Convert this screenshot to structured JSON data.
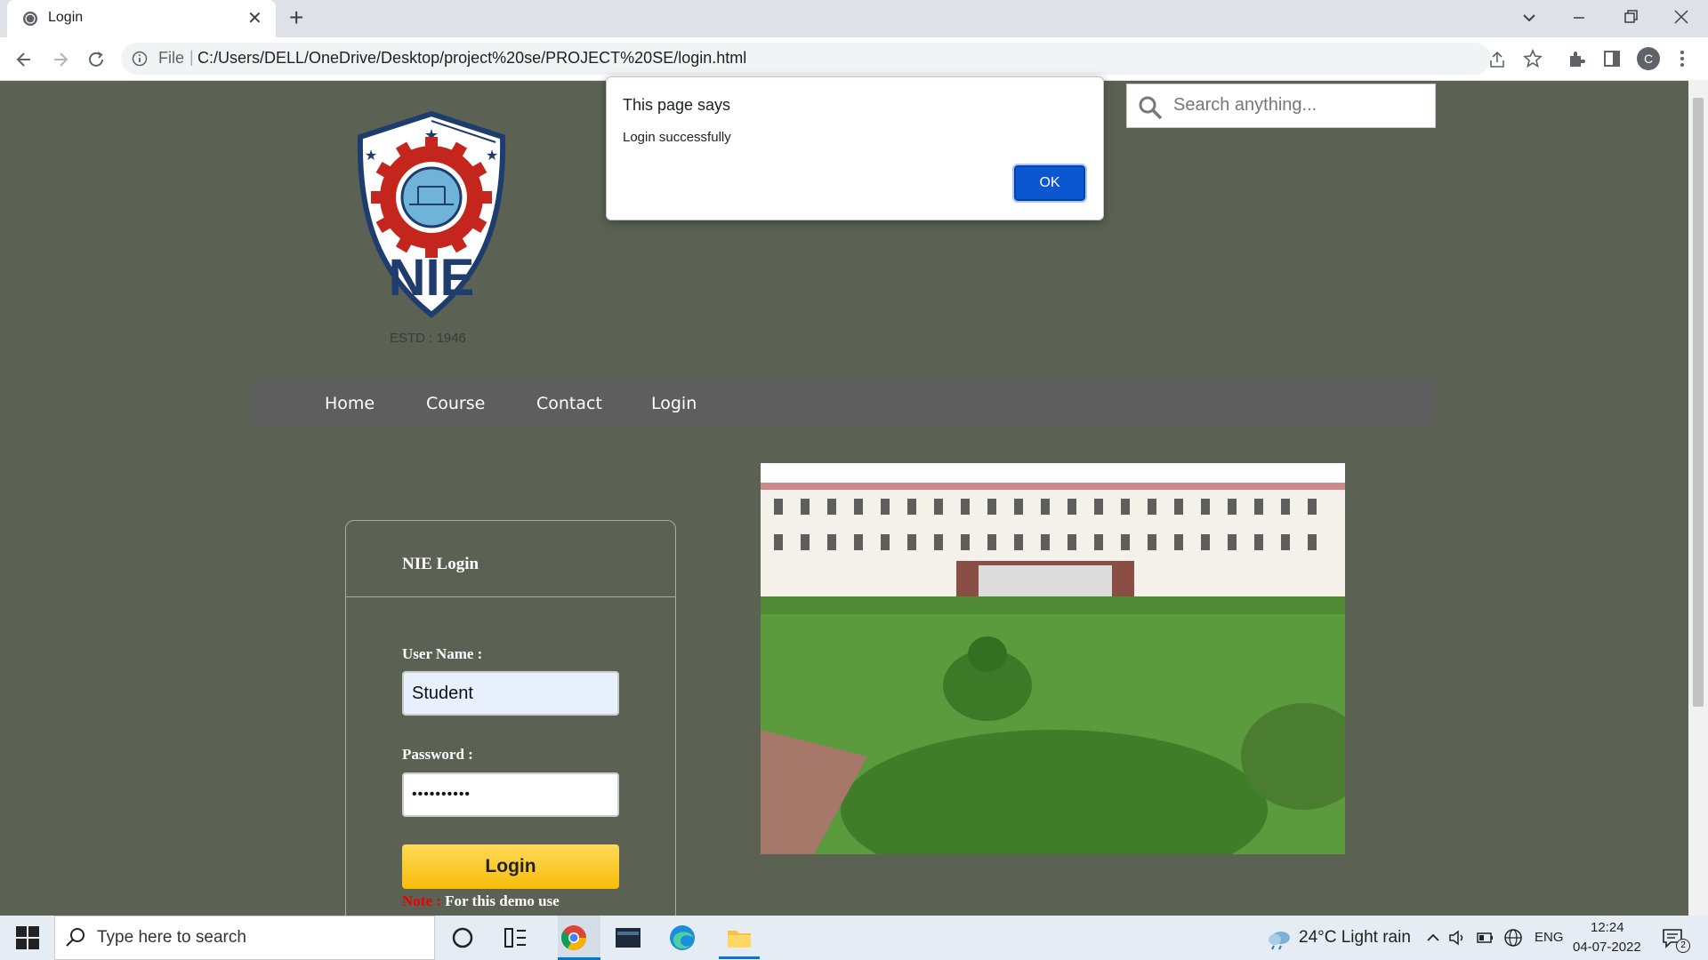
{
  "browser": {
    "tab_title": "Login",
    "tab_close": "✕",
    "new_tab": "+",
    "file_label": "File",
    "url": "C:/Users/DELL/OneDrive/Desktop/project%20se/PROJECT%20SE/login.html",
    "profile_initial": "C"
  },
  "page": {
    "logo_text": "NIE",
    "estd": "ESTD : 1946",
    "search_placeholder": "Search anything...",
    "nav": [
      "Home",
      "Course",
      "Contact",
      "Login"
    ],
    "login": {
      "title": "NIE Login",
      "username_label": "User Name :",
      "username_value": "Student",
      "password_label": "Password :",
      "password_value": "••••••••••",
      "button": "Login",
      "note_key": "Note :",
      "note_text": "For this demo use"
    }
  },
  "dialog": {
    "title": "This page says",
    "message": "Login successfully",
    "ok": "OK"
  },
  "taskbar": {
    "search_placeholder": "Type here to search",
    "weather": "24°C  Light rain",
    "lang": "ENG",
    "time": "12:24",
    "date": "04-07-2022",
    "notif_count": "2"
  },
  "colors": {
    "page_bg": "#5b6253",
    "menu_bg": "#5e5e5e",
    "button_yellow": "#f8bd0a",
    "ok_blue": "#0b57d0",
    "note_red": "#ee0000"
  }
}
